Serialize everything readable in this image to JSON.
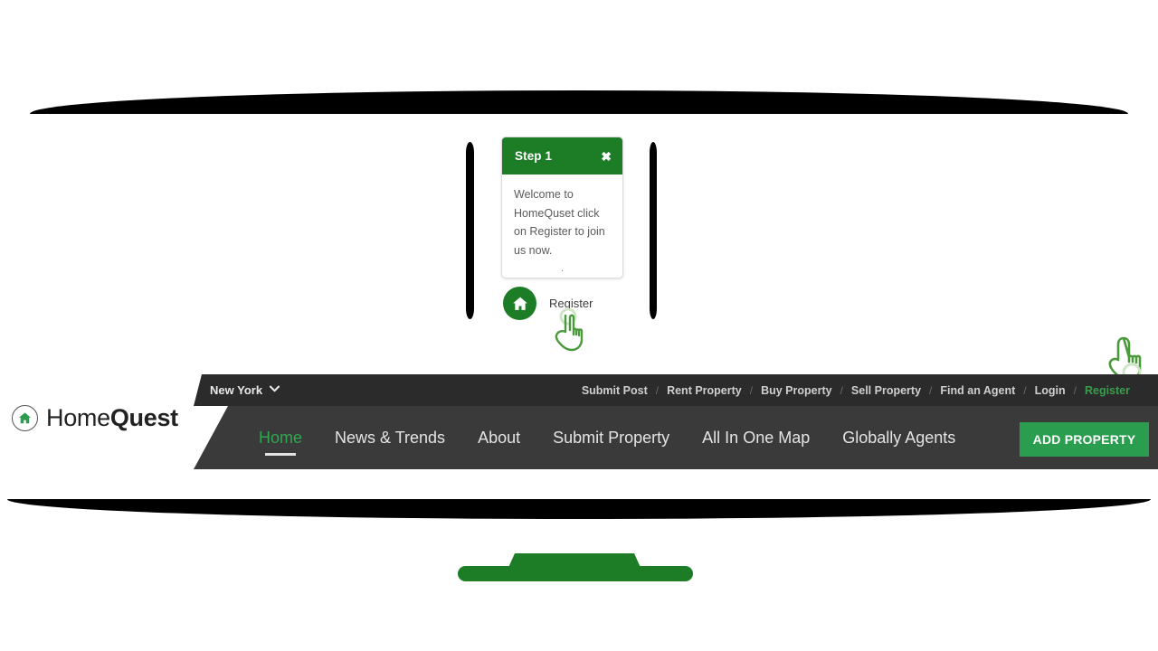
{
  "tour": {
    "step_title": "Step 1",
    "close_label": "✖",
    "body_text": "Welcome to HomeQuset click on Register to join us now.",
    "dot": ".",
    "target_label": "Register",
    "target_icon": "home-icon",
    "accent_color": "#1d7d26"
  },
  "cursors": {
    "pointer_one": "pointing-hand-cursor",
    "pointer_two": "pointing-hand-cursor",
    "color": "#4a9a3c"
  },
  "decor": {
    "band_color": "#000000",
    "stand_color": "#1d7d26"
  },
  "brand": {
    "name_light": "Home",
    "name_bold": "Quest",
    "icon": "house-in-circle-icon"
  },
  "topbar": {
    "city": "New York",
    "chevron": "❯",
    "background": "#2b2b2b",
    "links": [
      {
        "label": "Submit Post",
        "accent": false
      },
      {
        "label": "Rent Property",
        "accent": false
      },
      {
        "label": "Buy Property",
        "accent": false
      },
      {
        "label": "Sell Property",
        "accent": false
      },
      {
        "label": "Find an Agent",
        "accent": false
      },
      {
        "label": "Login",
        "accent": false
      },
      {
        "label": "Register",
        "accent": true
      }
    ],
    "separator": "/"
  },
  "navbar": {
    "background": "#3a3a3a",
    "active_color": "#2fa84f",
    "items": [
      {
        "label": "Home",
        "active": true
      },
      {
        "label": "News & Trends",
        "active": false
      },
      {
        "label": "About",
        "active": false
      },
      {
        "label": "Submit Property",
        "active": false
      },
      {
        "label": "All In One Map",
        "active": false
      },
      {
        "label": "Globally Agents",
        "active": false
      }
    ],
    "cta_label": "ADD PROPERTY",
    "cta_color": "#2a9d4e"
  }
}
